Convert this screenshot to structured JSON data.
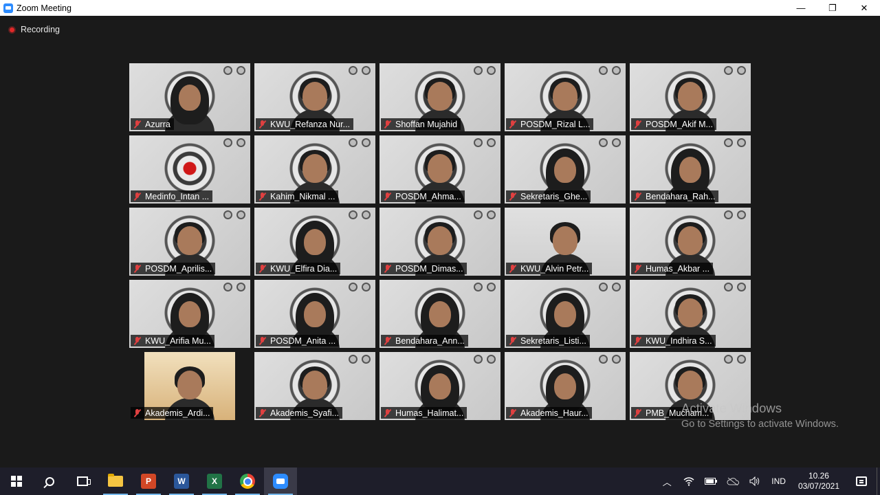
{
  "window": {
    "title": "Zoom Meeting",
    "minimize": "—",
    "restore": "❐",
    "close": "✕"
  },
  "recording": {
    "label": "Recording"
  },
  "participants": [
    {
      "name": "Azurra",
      "style": "hijab"
    },
    {
      "name": "KWU_Refanza Nur...",
      "style": "dark-hair",
      "active": true
    },
    {
      "name": "Shoffan Mujahid",
      "style": "dark-hair"
    },
    {
      "name": "POSDM_Rizal L...",
      "style": "dark-hair"
    },
    {
      "name": "POSDM_Akif M...",
      "style": "dark-hair"
    },
    {
      "name": "Medinfo_Intan ...",
      "style": "empty"
    },
    {
      "name": "Kahim_Nikmal ...",
      "style": "dark-hair"
    },
    {
      "name": "POSDM_Ahma...",
      "style": "dark-hair"
    },
    {
      "name": "Sekretaris_Ghe...",
      "style": "hijab"
    },
    {
      "name": "Bendahara_Rah...",
      "style": "hijab"
    },
    {
      "name": "POSDM_Aprilis...",
      "style": "dark-hair"
    },
    {
      "name": "KWU_Elfira Dia...",
      "style": "hijab"
    },
    {
      "name": "POSDM_Dimas...",
      "style": "dark-hair"
    },
    {
      "name": "KWU_Alvin Petr...",
      "style": "dark-hair",
      "plain": true
    },
    {
      "name": "Humas_Akbar ...",
      "style": "dark-hair"
    },
    {
      "name": "KWU_Arifia Mu...",
      "style": "hijab"
    },
    {
      "name": "POSDM_Anita ...",
      "style": "hijab"
    },
    {
      "name": "Bendahara_Ann...",
      "style": "hijab"
    },
    {
      "name": "Sekretaris_Listi...",
      "style": "hijab"
    },
    {
      "name": "KWU_Indhira S...",
      "style": "dark-hair"
    },
    {
      "name": "Akademis_Ardi...",
      "style": "dark-hair",
      "dark": true
    },
    {
      "name": "Akademis_Syafi...",
      "style": "dark-hair"
    },
    {
      "name": "Humas_Halimat...",
      "style": "hijab"
    },
    {
      "name": "Akademis_Haur...",
      "style": "hijab"
    },
    {
      "name": "PMB_Mucham...",
      "style": "dark-hair"
    }
  ],
  "watermark": {
    "title": "Activate Windows",
    "subtitle": "Go to Settings to activate Windows."
  },
  "taskbar": {
    "apps": [
      "start",
      "search",
      "task-view",
      "file-explorer",
      "powerpoint",
      "word",
      "excel",
      "chrome",
      "zoom"
    ],
    "powerpoint_letter": "P",
    "word_letter": "W",
    "excel_letter": "X",
    "tray_chevron": "︿",
    "language": "IND",
    "time": "10.26",
    "date": "03/07/2021"
  },
  "colors": {
    "active_speaker": "#c8e64a",
    "muted_mic": "#e04040",
    "zoom_blue": "#2d8cff"
  }
}
